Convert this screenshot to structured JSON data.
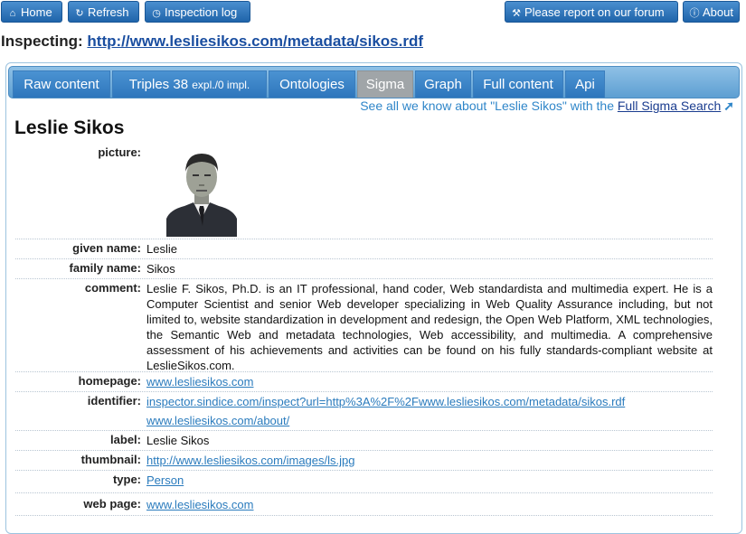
{
  "nav": {
    "home": "Home",
    "refresh": "Refresh",
    "inspection_log": "Inspection log",
    "report": "Please report on our forum",
    "about": "About"
  },
  "inspecting": {
    "label": "Inspecting:",
    "url": "http://www.lesliesikos.com/metadata/sikos.rdf"
  },
  "tabs": {
    "raw": "Raw content",
    "triples": "Triples 38",
    "triples_detail": "expl./0 impl.",
    "ontologies": "Ontologies",
    "sigma": "Sigma",
    "graph": "Graph",
    "full": "Full content",
    "api": "Api",
    "active": "Sigma"
  },
  "sigma_search": {
    "prefix": "See all we know about \"Leslie Sikos\" with the",
    "link": "Full Sigma Search"
  },
  "entity": {
    "title": "Leslie Sikos",
    "picture_label": "picture:",
    "given_name_label": "given name:",
    "given_name": "Leslie",
    "family_name_label": "family name:",
    "family_name": "Sikos",
    "comment_label": "comment:",
    "comment": "Leslie F. Sikos, Ph.D. is an IT professional, hand coder, Web standardista and multimedia expert. He is a Computer Scientist and senior Web developer specializing in Web Quality Assurance including, but not limited to, website standardization in development and redesign, the Open Web Platform, XML technologies, the Semantic Web and metadata technologies, Web accessibility, and multimedia. A comprehensive assessment of his achievements and activities can be found on his fully standards-compliant website at LeslieSikos.com.",
    "homepage_label": "homepage:",
    "homepage": "www.lesliesikos.com",
    "identifier_label": "identifier:",
    "identifier_1": "inspector.sindice.com/inspect?url=http%3A%2F%2Fwww.lesliesikos.com/metadata/sikos.rdf",
    "identifier_2": "www.lesliesikos.com/about/",
    "label_label": "label:",
    "label": "Leslie Sikos",
    "thumbnail_label": "thumbnail:",
    "thumbnail": "http://www.lesliesikos.com/images/ls.jpg",
    "type_label": "type:",
    "type": "Person",
    "webpage_label": "web page:",
    "webpage": "www.lesliesikos.com"
  },
  "colors": {
    "button_blue": "#2f76bd",
    "tab_active": "#a0a5a8",
    "link": "#2a7bbd"
  },
  "icons": [
    "home-icon",
    "refresh-icon",
    "clock-icon",
    "wrench-icon",
    "info-icon",
    "arrow-icon"
  ]
}
